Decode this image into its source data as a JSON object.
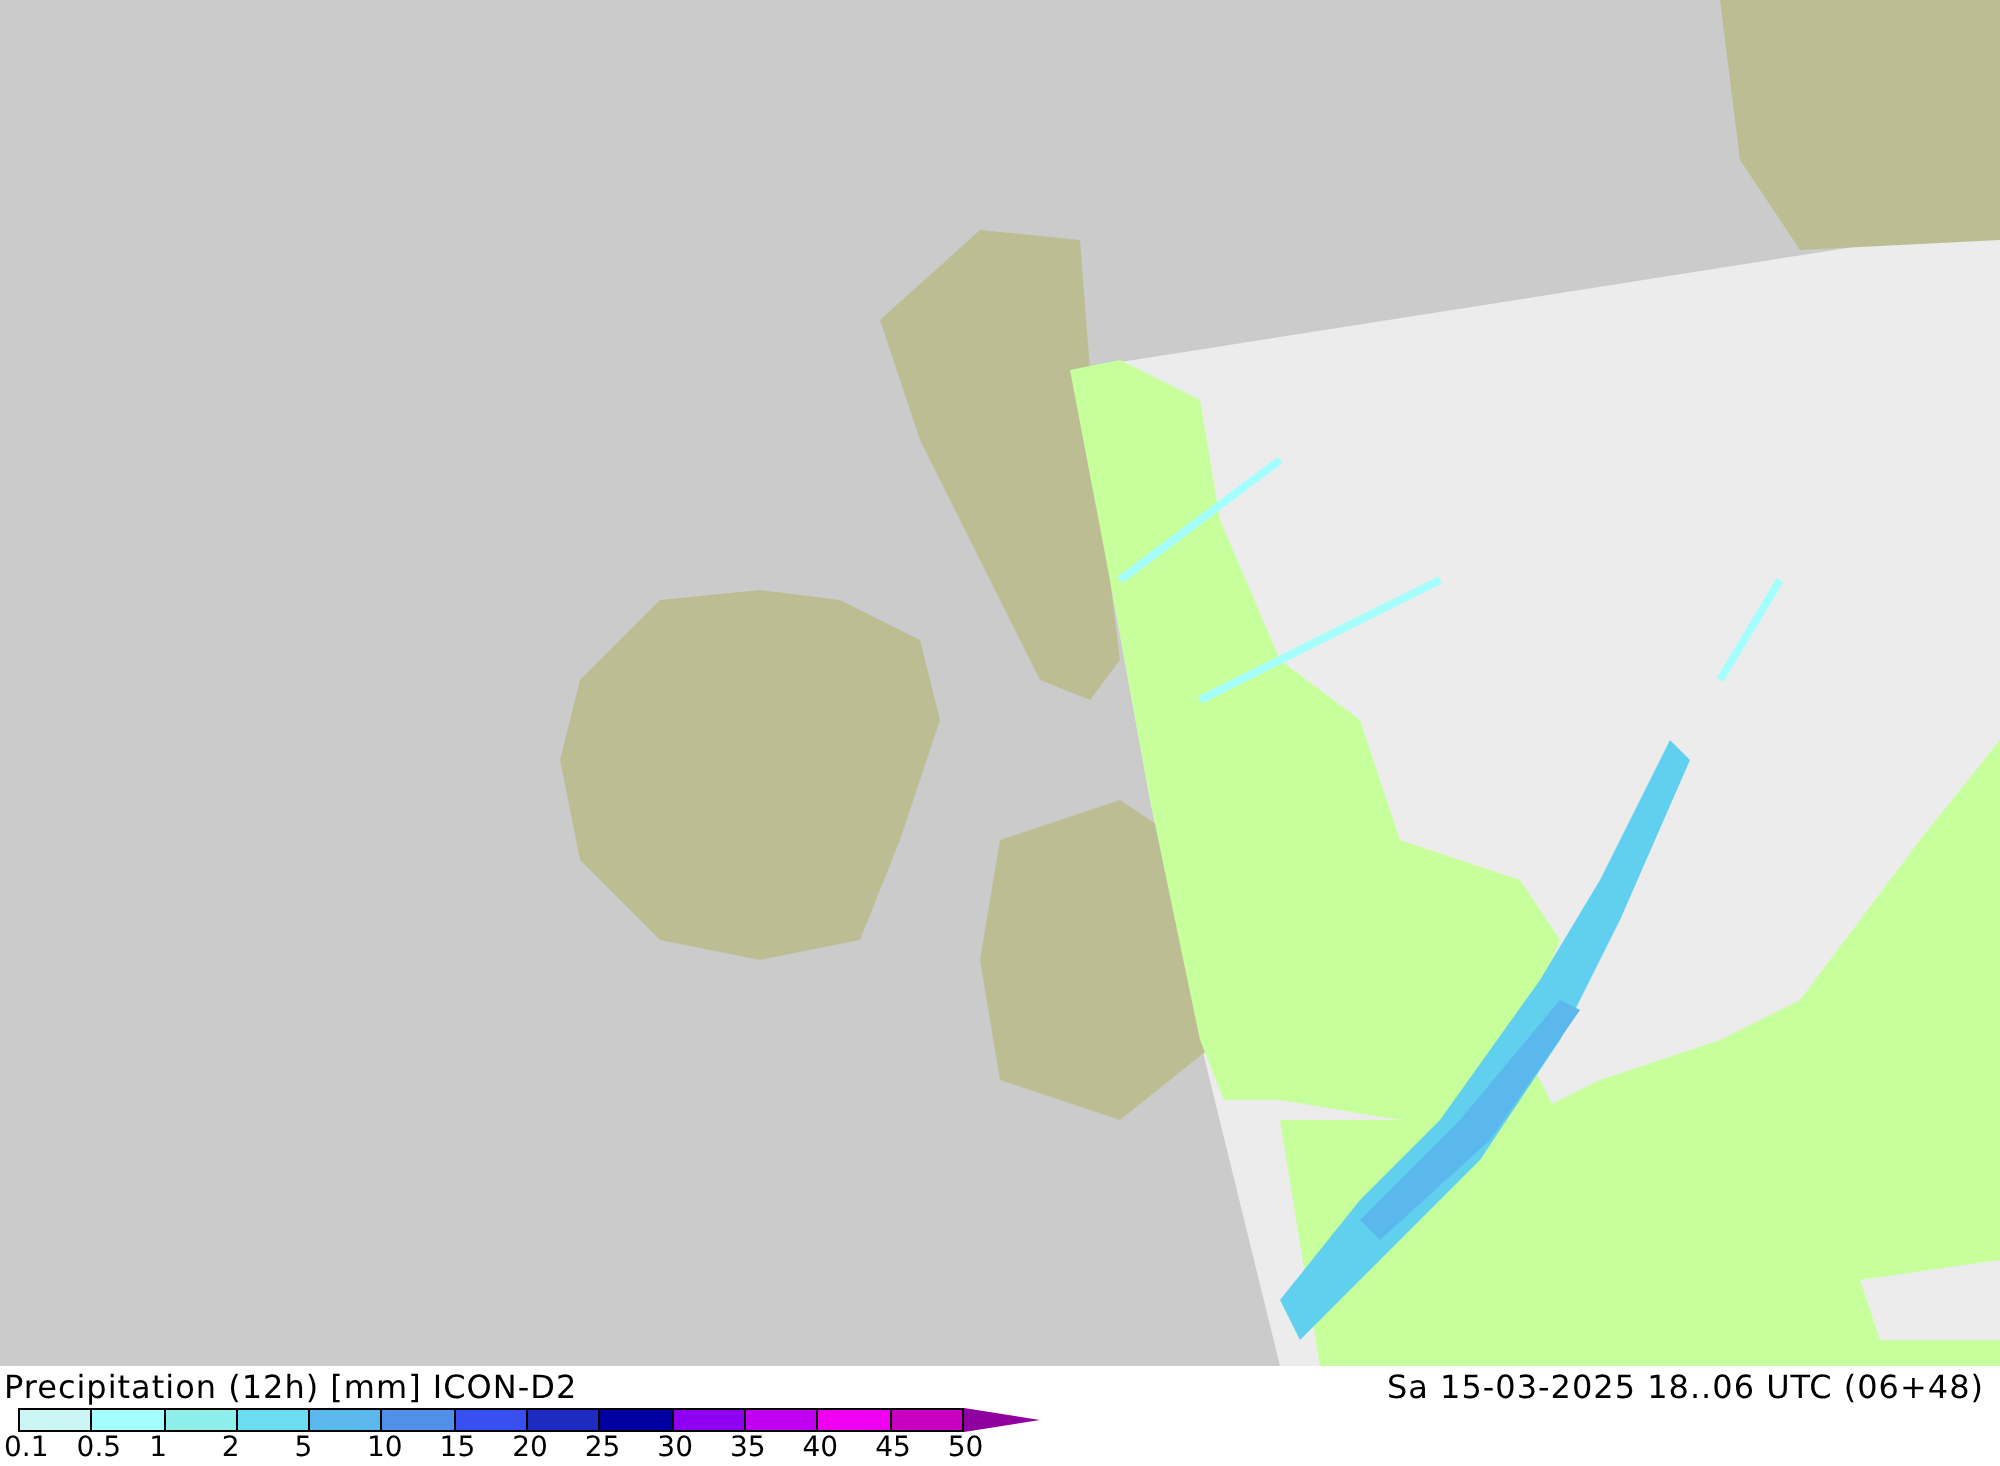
{
  "map": {
    "title": "Precipitation (12h) [mm] ICON-D2",
    "valid_time": "Sa 15-03-2025 18..06 UTC (06+48)"
  },
  "legend": {
    "bins": [
      {
        "color": "#ccf6f6"
      },
      {
        "color": "#a4fefe"
      },
      {
        "color": "#8eeeea"
      },
      {
        "color": "#6cdcf0"
      },
      {
        "color": "#5ab8ec"
      },
      {
        "color": "#5090e8"
      },
      {
        "color": "#3850f0"
      },
      {
        "color": "#1c2cc0"
      },
      {
        "color": "#0000a0"
      },
      {
        "color": "#9000f0"
      },
      {
        "color": "#c000f0"
      },
      {
        "color": "#f000f0"
      },
      {
        "color": "#c800c0"
      }
    ],
    "overflow": {
      "color": "#9000a0"
    },
    "labels": [
      "0.1",
      "0.5",
      "1",
      "2",
      "5",
      "10",
      "15",
      "20",
      "25",
      "30",
      "35",
      "40",
      "45",
      "50"
    ]
  }
}
